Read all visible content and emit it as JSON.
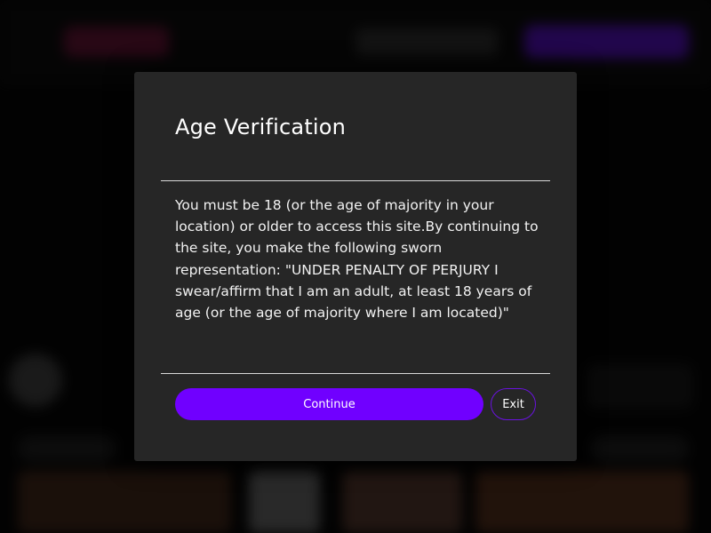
{
  "modal": {
    "title": "Age Verification",
    "body": "You must be 18 (or the age of majority in your location) or older to access this site.By continuing to the site, you make the following sworn representation: \"UNDER PENALTY OF PERJURY I swear/affirm that I am an adult, at least 18 years of age (or the age of majority where I am located)\"",
    "continue_label": "Continue",
    "exit_label": "Exit"
  },
  "colors": {
    "accent": "#7000ff",
    "modal_background": "#262626",
    "page_background": "#060606"
  }
}
